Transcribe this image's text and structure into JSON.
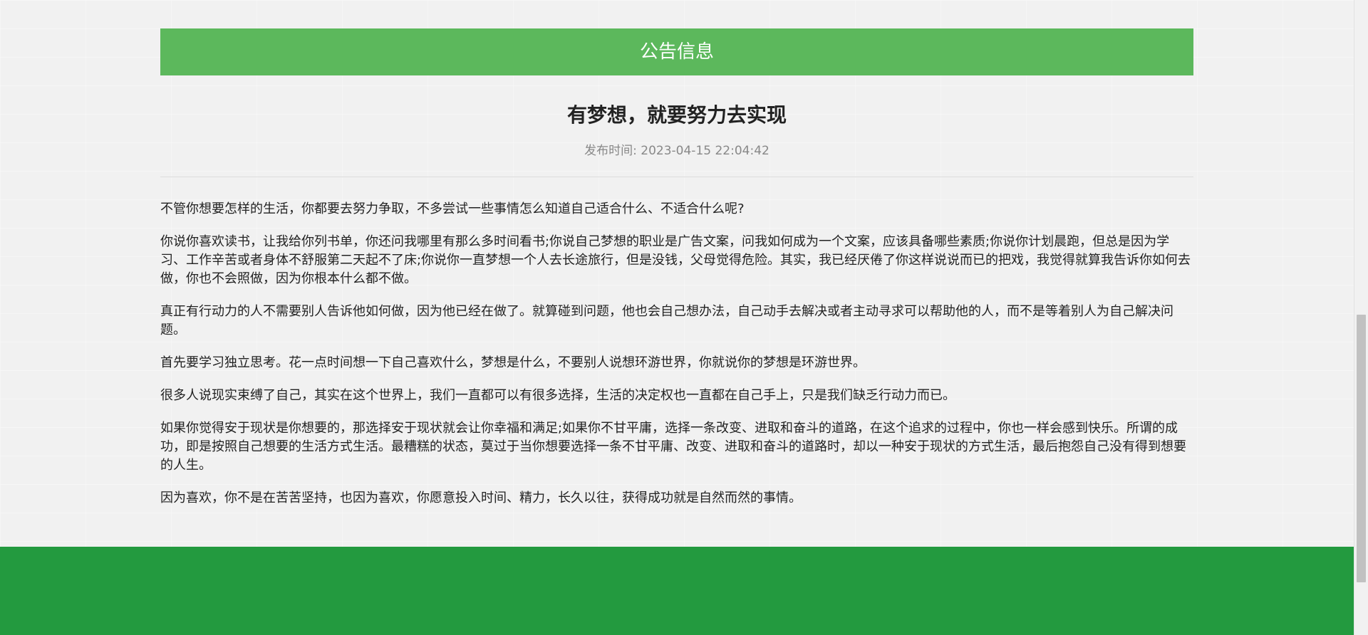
{
  "notice": {
    "header_label": "公告信息"
  },
  "article": {
    "title": "有梦想，就要努力去实现",
    "publish_label": "发布时间:",
    "publish_time": "2023-04-15 22:04:42",
    "paragraphs": [
      "不管你想要怎样的生活，你都要去努力争取，不多尝试一些事情怎么知道自己适合什么、不适合什么呢?",
      "你说你喜欢读书，让我给你列书单，你还问我哪里有那么多时间看书;你说自己梦想的职业是广告文案，问我如何成为一个文案，应该具备哪些素质;你说你计划晨跑，但总是因为学习、工作辛苦或者身体不舒服第二天起不了床;你说你一直梦想一个人去长途旅行，但是没钱，父母觉得危险。其实，我已经厌倦了你这样说说而已的把戏，我觉得就算我告诉你如何去做，你也不会照做，因为你根本什么都不做。",
      "真正有行动力的人不需要别人告诉他如何做，因为他已经在做了。就算碰到问题，他也会自己想办法，自己动手去解决或者主动寻求可以帮助他的人，而不是等着别人为自己解决问题。",
      "首先要学习独立思考。花一点时间想一下自己喜欢什么，梦想是什么，不要别人说想环游世界，你就说你的梦想是环游世界。",
      "很多人说现实束缚了自己，其实在这个世界上，我们一直都可以有很多选择，生活的决定权也一直都在自己手上，只是我们缺乏行动力而已。",
      "如果你觉得安于现状是你想要的，那选择安于现状就会让你幸福和满足;如果你不甘平庸，选择一条改变、进取和奋斗的道路，在这个追求的过程中，你也一样会感到快乐。所谓的成功，即是按照自己想要的生活方式生活。最糟糕的状态，莫过于当你想要选择一条不甘平庸、改变、进取和奋斗的道路时，却以一种安于现状的方式生活，最后抱怨自己没有得到想要的人生。",
      "因为喜欢，你不是在苦苦坚持，也因为喜欢，你愿意投入时间、精力，长久以往，获得成功就是自然而然的事情。"
    ]
  },
  "colors": {
    "header_green": "#5cb85c",
    "footer_green": "#239a3f",
    "background": "#f1f1f1"
  }
}
